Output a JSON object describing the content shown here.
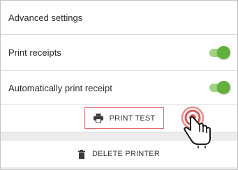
{
  "settings": {
    "advanced_label": "Advanced settings",
    "print_receipts_label": "Print receipts",
    "auto_print_label": "Automatically print receipt"
  },
  "toggles": {
    "print_receipts": true,
    "auto_print": true,
    "on_color": "#61b13b"
  },
  "actions": {
    "print_test_label": "PRINT TEST",
    "print_test_icon": "printer-icon",
    "delete_printer_label": "DELETE PRINTER",
    "delete_printer_icon": "trash-icon",
    "highlight_color": "#e06b6b"
  },
  "overlay": {
    "pointer_icon": "tap-hand-icon"
  }
}
